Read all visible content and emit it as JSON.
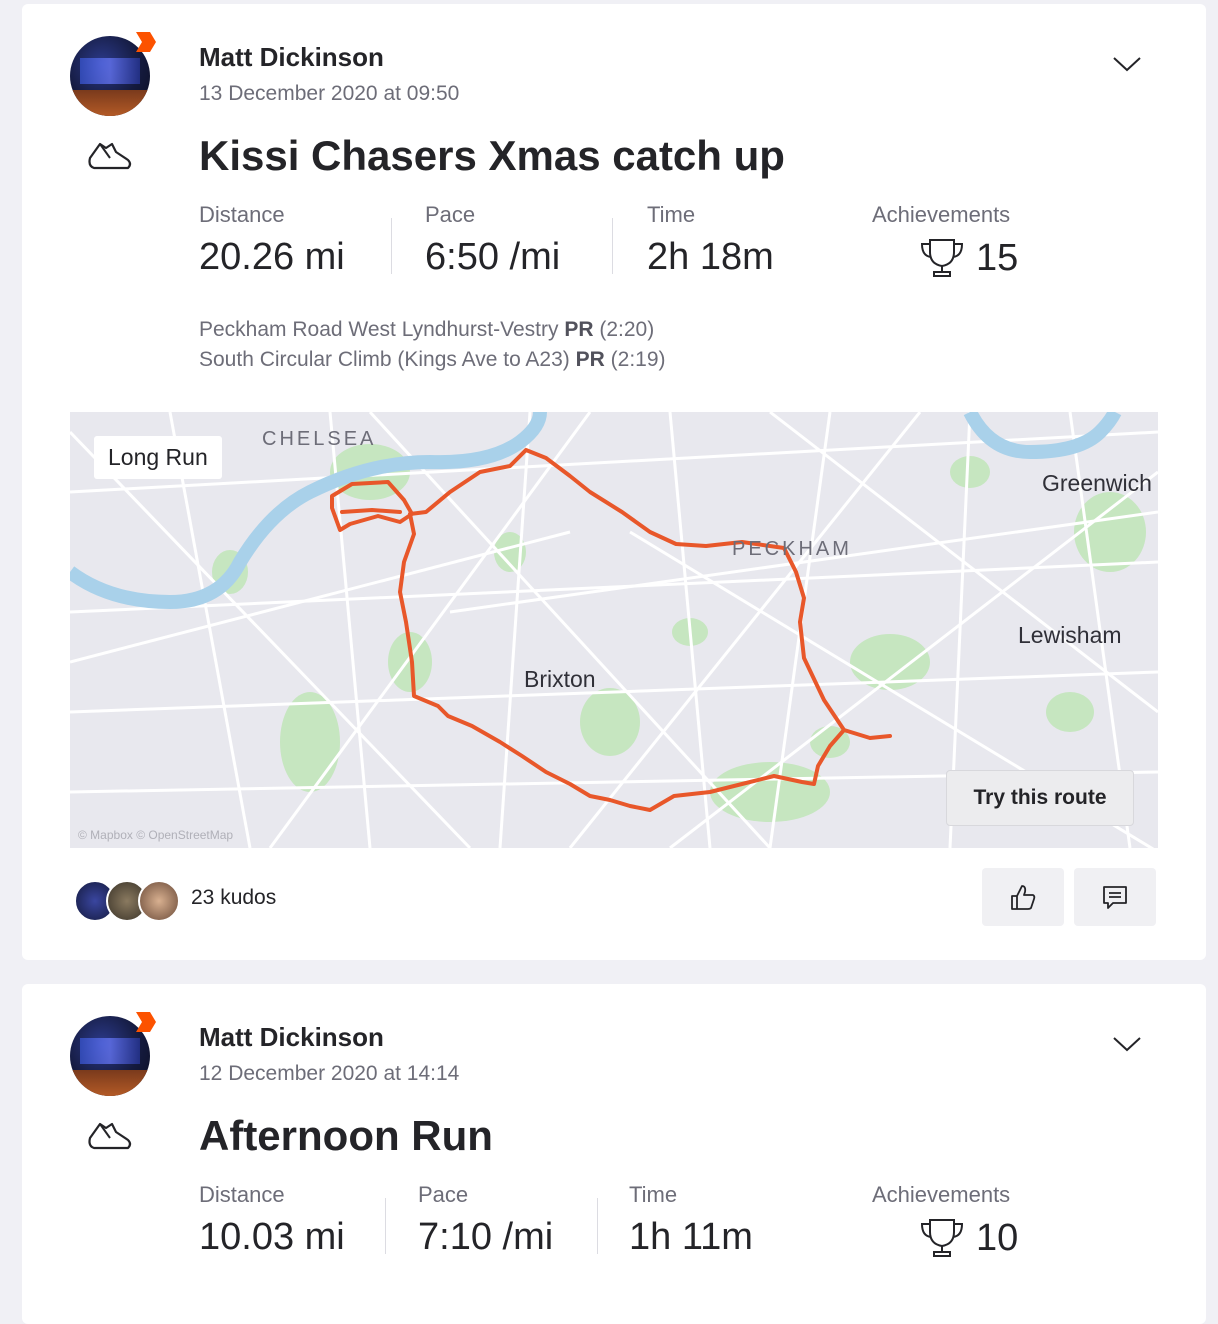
{
  "activities": [
    {
      "athlete": "Matt Dickinson",
      "date": "13 December 2020 at 09:50",
      "title": "Kissi Chasers Xmas catch up",
      "stats": {
        "distance_label": "Distance",
        "distance": "20.26 mi",
        "pace_label": "Pace",
        "pace": "6:50 /mi",
        "time_label": "Time",
        "time": "2h 18m",
        "achievements_label": "Achievements",
        "achievements": "15"
      },
      "segments": [
        {
          "name": "Peckham Road West Lyndhurst-Vestry",
          "badge": "PR",
          "time": "(2:20)"
        },
        {
          "name": "South Circular Climb (Kings Ave to A23)",
          "badge": "PR",
          "time": "(2:19)"
        }
      ],
      "map": {
        "tag": "Long Run",
        "labels": {
          "chelsea": "CHELSEA",
          "greenwich": "Greenwich",
          "peckham": "PECKHAM",
          "lewisham": "Lewisham",
          "brixton": "Brixton"
        },
        "try_route": "Try this route",
        "attribution": "© Mapbox © OpenStreetMap"
      },
      "kudos": "23 kudos"
    },
    {
      "athlete": "Matt Dickinson",
      "date": "12 December 2020 at 14:14",
      "title": "Afternoon Run",
      "stats": {
        "distance_label": "Distance",
        "distance": "10.03 mi",
        "pace_label": "Pace",
        "pace": "7:10 /mi",
        "time_label": "Time",
        "time": "1h 11m",
        "achievements_label": "Achievements",
        "achievements": "10"
      }
    }
  ],
  "icons": {
    "shoe": "running-shoe-icon",
    "chevron": "chevron-down-icon",
    "trophy": "trophy-icon",
    "thumbs": "thumbs-up-icon",
    "comment": "comment-icon",
    "badge": "subscriber-badge-icon"
  },
  "colors": {
    "route": "#e8572a",
    "brand": "#fc5200",
    "water": "#a9d1ea",
    "park": "#c6e6c0"
  }
}
